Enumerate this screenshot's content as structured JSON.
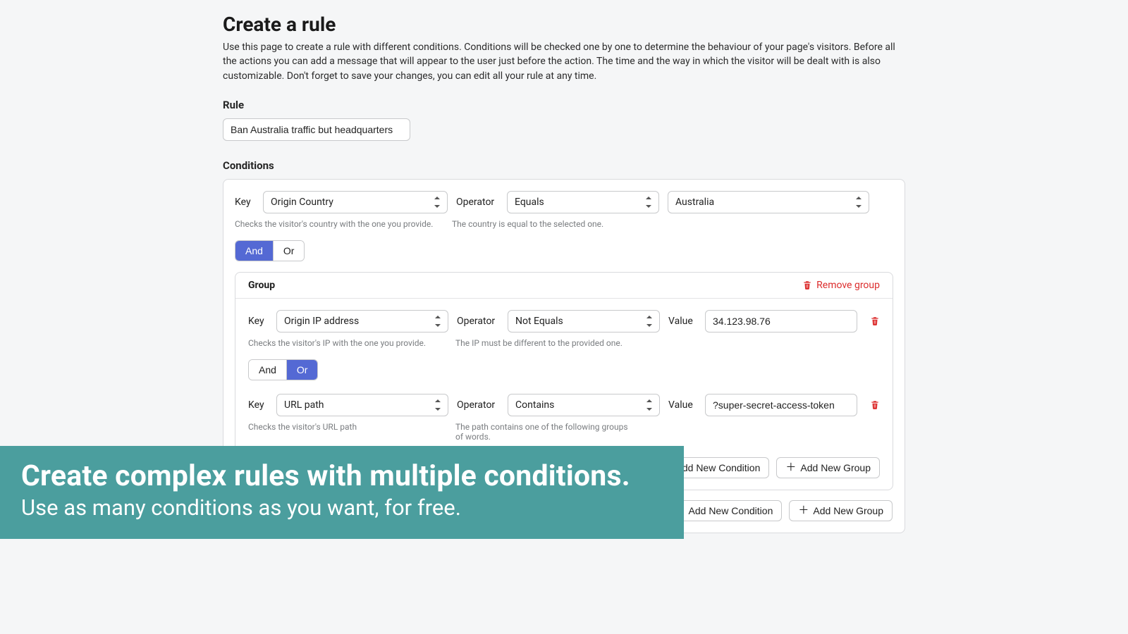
{
  "page": {
    "title": "Create a rule",
    "description": "Use this page to create a rule with different conditions. Conditions will be checked one by one to determine the behaviour of your page's visitors. Before all the actions you can add a message that will appear to the user just before the action. The time and the way in which the visitor will be dealt with is also customizable. Don't forget to save your changes, you can edit all your rule at any time."
  },
  "rule": {
    "label": "Rule",
    "name": "Ban Australia traffic but headquarters"
  },
  "conditions": {
    "label": "Conditions",
    "labels": {
      "key": "Key",
      "operator": "Operator",
      "value": "Value"
    },
    "and_or": {
      "and": "And",
      "or": "Or"
    },
    "root": {
      "condition1": {
        "key": "Origin Country",
        "operator": "Equals",
        "value": "Australia",
        "key_hint": "Checks the visitor's country with the one you provide.",
        "op_hint": "The country is equal to the selected one."
      },
      "connector_active": "and",
      "group": {
        "title": "Group",
        "remove_label": "Remove group",
        "condition1": {
          "key": "Origin IP address",
          "operator": "Not Equals",
          "value": "34.123.98.76",
          "key_hint": "Checks the visitor's IP with the one you provide.",
          "op_hint": "The IP must be different to the provided one."
        },
        "connector_active": "or",
        "condition2": {
          "key": "URL path",
          "operator": "Contains",
          "value": "?super-secret-access-token",
          "key_hint": "Checks the visitor's URL path",
          "op_hint": "The path contains one of the following groups of words."
        }
      }
    }
  },
  "buttons": {
    "add_condition": "Add New Condition",
    "add_group": "Add New Group"
  },
  "banner": {
    "title": "Create complex rules with multiple conditions.",
    "subtitle": "Use as many conditions as you want, for free."
  }
}
